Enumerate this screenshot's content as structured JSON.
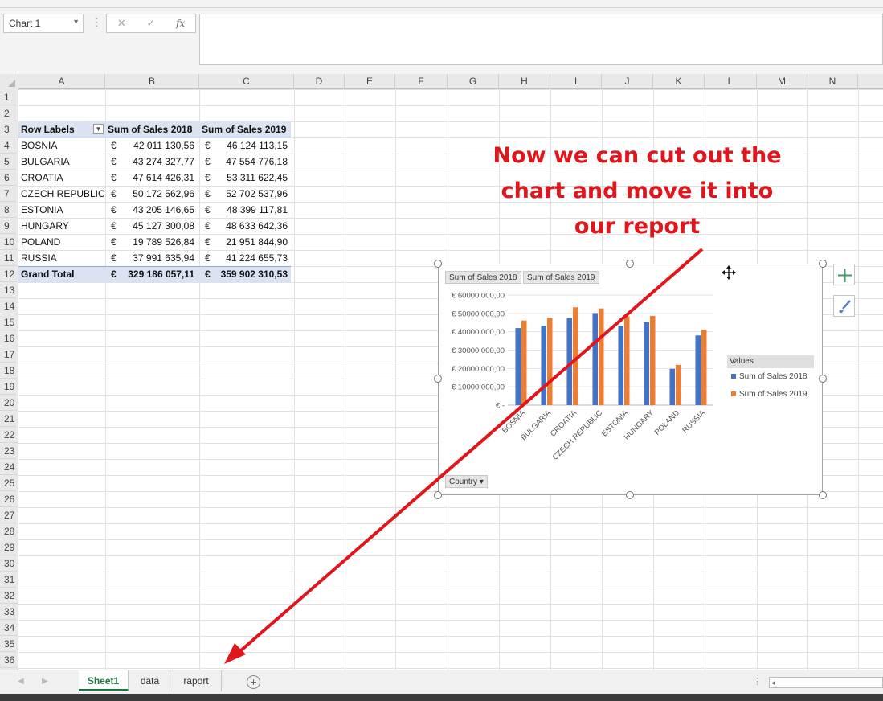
{
  "formula_bar": {
    "name_box": "Chart 1",
    "cancel_icon": "✕",
    "enter_icon": "✓",
    "fx_label": "fx",
    "formula_value": ""
  },
  "columns": [
    "A",
    "B",
    "C",
    "D",
    "E",
    "F",
    "G",
    "H",
    "I",
    "J",
    "K",
    "L",
    "M",
    "N"
  ],
  "rows": [
    "1",
    "2",
    "3",
    "4",
    "5",
    "6",
    "7",
    "8",
    "9",
    "10",
    "11",
    "12",
    "13",
    "14",
    "15",
    "16",
    "17",
    "18",
    "19",
    "20",
    "21",
    "22",
    "23",
    "24",
    "25",
    "26",
    "27",
    "28",
    "29",
    "30",
    "31",
    "32",
    "33",
    "34",
    "35",
    "36"
  ],
  "pivot": {
    "headers": [
      "Row Labels",
      "Sum of Sales 2018",
      "Sum of Sales 2019"
    ],
    "currency": "€",
    "rows": [
      {
        "label": "BOSNIA",
        "v2018": "42 011 130,56",
        "v2019": "46 124 113,15"
      },
      {
        "label": "BULGARIA",
        "v2018": "43 274 327,77",
        "v2019": "47 554 776,18"
      },
      {
        "label": "CROATIA",
        "v2018": "47 614 426,31",
        "v2019": "53 311 622,45"
      },
      {
        "label": "CZECH REPUBLIC",
        "v2018": "50 172 562,96",
        "v2019": "52 702 537,96"
      },
      {
        "label": "ESTONIA",
        "v2018": "43 205 146,65",
        "v2019": "48 399 117,81"
      },
      {
        "label": "HUNGARY",
        "v2018": "45 127 300,08",
        "v2019": "48 633 642,36"
      },
      {
        "label": "POLAND",
        "v2018": "19 789 526,84",
        "v2019": "21 951 844,90"
      },
      {
        "label": "RUSSIA",
        "v2018": "37 991 635,94",
        "v2019": "41 224 655,73"
      }
    ],
    "total": {
      "label": "Grand Total",
      "v2018": "329 186 057,11",
      "v2019": "359 902 310,53"
    }
  },
  "annotation": {
    "line1": "Now we can cut out the",
    "line2": "chart and move it into",
    "line3": "our report",
    "color": "#e0161d"
  },
  "chart_data": {
    "type": "bar",
    "categories": [
      "BOSNIA",
      "BULGARIA",
      "CROATIA",
      "CZECH REPUBLIC",
      "ESTONIA",
      "HUNGARY",
      "POLAND",
      "RUSSIA"
    ],
    "series": [
      {
        "name": "Sum of Sales 2018",
        "values": [
          42011130.56,
          43274327.77,
          47614426.31,
          50172562.96,
          43205146.65,
          45127300.08,
          19789526.84,
          37991635.94
        ],
        "color": "#4472c4"
      },
      {
        "name": "Sum of Sales 2019",
        "values": [
          46124113.15,
          47554776.18,
          53311622.45,
          52702537.96,
          48399117.81,
          48633642.36,
          21951844.9,
          41224655.73
        ],
        "color": "#ed7d31"
      }
    ],
    "ylim": [
      0,
      60000000
    ],
    "ytick_labels": [
      "€ -",
      "€ 10000 000,00",
      "€ 20000 000,00",
      "€ 30000 000,00",
      "€ 40000 000,00",
      "€ 50000 000,00",
      "€ 60000 000,00"
    ],
    "field_buttons": [
      "Sum of Sales 2018",
      "Sum of Sales 2019"
    ],
    "axis_field_button": "Country ▾",
    "legend_title": "Values",
    "legend_position": "right",
    "grid": true
  },
  "sheet_tabs": [
    {
      "label": "Sheet1",
      "active": true
    },
    {
      "label": "data",
      "active": false
    },
    {
      "label": "raport",
      "active": false
    }
  ],
  "add_sheet_icon": "+",
  "chart_side_buttons": [
    "chart-elements-plus-icon",
    "chart-styles-brush-icon"
  ]
}
